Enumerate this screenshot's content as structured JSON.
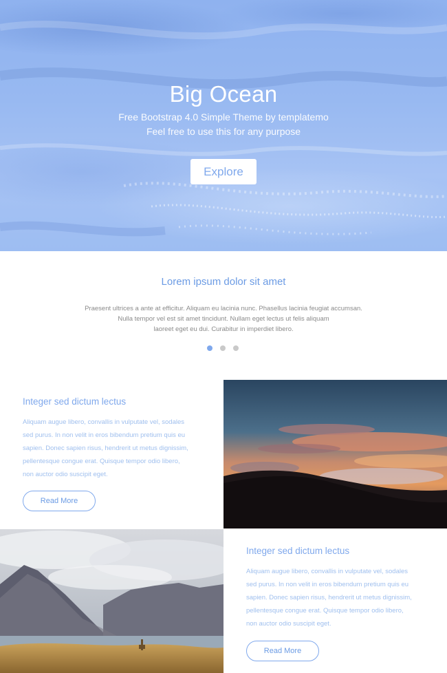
{
  "hero": {
    "title": "Big Ocean",
    "subtitle_line1": "Free Bootstrap 4.0 Simple Theme by templatemo",
    "subtitle_line2": "Feel free to use this for any purpose",
    "explore_label": "Explore"
  },
  "intro": {
    "title": "Lorem ipsum dolor sit amet",
    "lines": [
      "Praesent ultrices a ante at efficitur. Aliquam eu lacinia nunc. Phasellus lacinia feugiat accumsan.",
      "Nulla tempor vel est sit amet tincidunt. Nullam eget lectus ut felis aliquam",
      "laoreet eget eu dui. Curabitur in imperdiet libero."
    ],
    "carousel_dots": 3,
    "active_dot": 1
  },
  "feature1": {
    "title": "Integer sed dictum lectus",
    "lines": [
      "Aliquam augue libero, convallis in vulputate vel, sodales",
      "sed purus. In non velit in eros bibendum pretium quis eu",
      "sapien. Donec sapien risus, hendrerit ut metus dignissim,",
      "pellentesque congue erat. Quisque tempor odio libero,",
      "non auctor odio suscipit eget."
    ],
    "button_label": "Read More"
  },
  "feature2": {
    "title": "Integer sed dictum lectus",
    "lines": [
      "Aliquam augue libero, convallis in vulputate vel, sodales",
      "sed purus. In non velit in eros bibendum pretium quis eu",
      "sapien. Donec sapien risus, hendrerit ut metus dignissim,",
      "pellentesque congue erat. Quisque tempor odio libero,",
      "non auctor odio suscipit eget."
    ],
    "button_label": "Read More"
  },
  "colors": {
    "accent": "#7fa8ec",
    "hero_sky": "#98b9f1",
    "body_text": "#8a8a8a"
  },
  "images": {
    "sunset": "sunset-over-clouds-photo",
    "mountains": "mountain-lake-landscape-photo"
  }
}
